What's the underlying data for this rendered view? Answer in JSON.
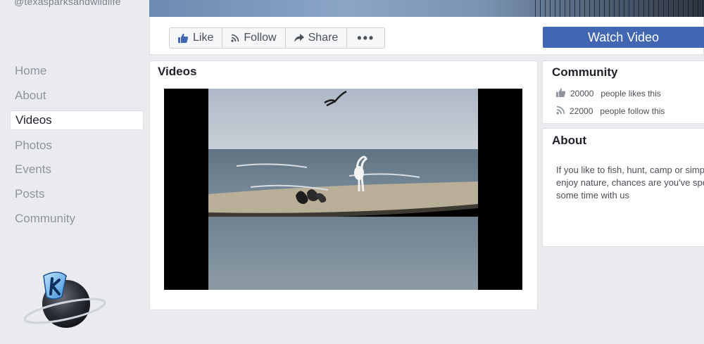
{
  "page": {
    "handle": "@texasparksandwildlife"
  },
  "actions": {
    "like_label": "Like",
    "follow_label": "Follow",
    "share_label": "Share",
    "more_label": "•••",
    "watch_video_label": "Watch Video"
  },
  "sidebar": {
    "items": [
      {
        "label": "Home",
        "active": false
      },
      {
        "label": "About",
        "active": false
      },
      {
        "label": "Videos",
        "active": true
      },
      {
        "label": "Photos",
        "active": false
      },
      {
        "label": "Events",
        "active": false
      },
      {
        "label": "Posts",
        "active": false
      },
      {
        "label": "Community",
        "active": false
      }
    ]
  },
  "videos": {
    "title": "Videos"
  },
  "community": {
    "title": "Community",
    "likes_count": "20000",
    "likes_text": "people likes this",
    "follows_count": "22000",
    "follows_text": "people follow this"
  },
  "about": {
    "title": "About",
    "lines": [
      "If you like to fish, hunt, camp or simp",
      "enjoy nature, chances are you've spe",
      "some time with us"
    ]
  },
  "colors": {
    "brand_blue": "#4267b2",
    "page_bg": "#e9ebee",
    "muted_text": "#90949c"
  },
  "icons": {
    "like": "thumbs-up-icon",
    "follow": "rss-icon",
    "share": "share-arrow-icon",
    "more": "more-dots-icon",
    "logo": "k-planet-logo"
  }
}
